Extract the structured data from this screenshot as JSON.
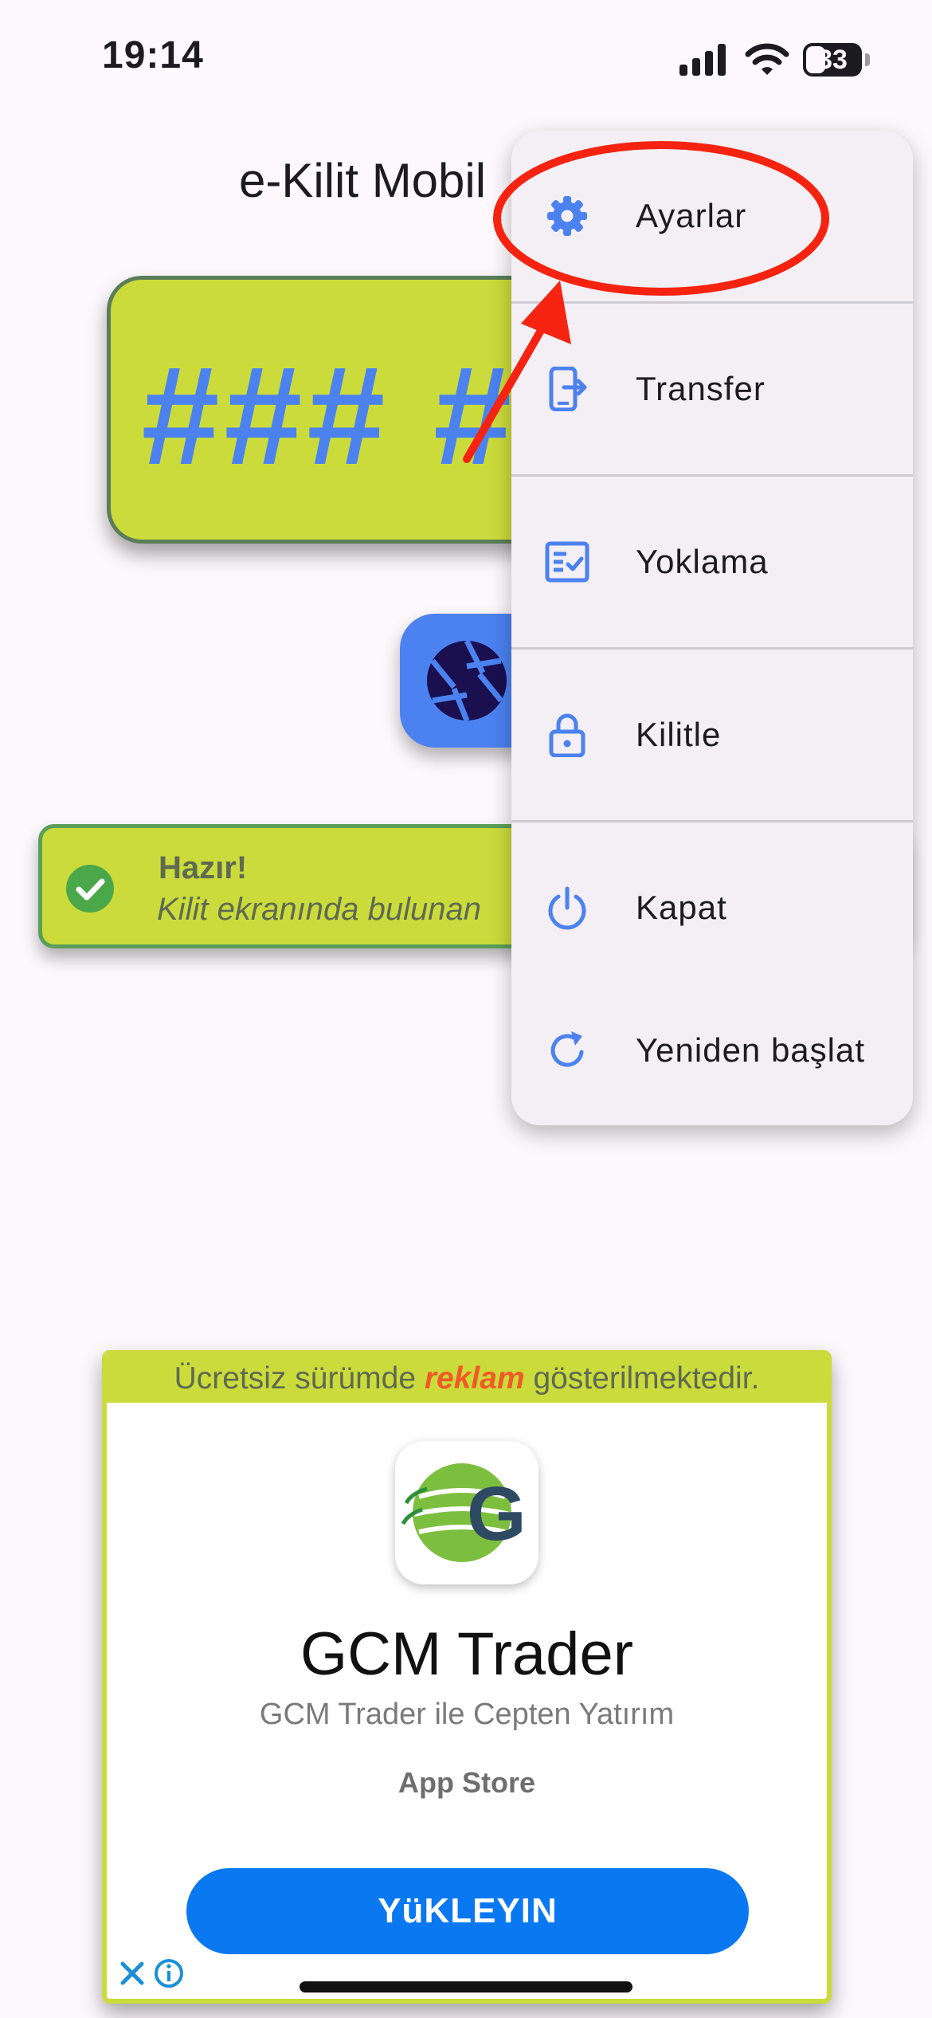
{
  "status_bar": {
    "time": "19:14",
    "battery": "33"
  },
  "app": {
    "title": "e-Kilit Mobil"
  },
  "code_card": {
    "code": "### #"
  },
  "status": {
    "title": "Hazır!",
    "message": "Kilit ekranında bulunan"
  },
  "menu": {
    "items": [
      {
        "label": "Ayarlar",
        "icon": "gear-icon"
      },
      {
        "label": "Transfer",
        "icon": "phone-transfer-icon"
      },
      {
        "label": "Yoklama",
        "icon": "checklist-icon"
      },
      {
        "label": "Kilitle",
        "icon": "lock-icon"
      },
      {
        "label": "Kapat",
        "icon": "power-icon"
      },
      {
        "label": "Yeniden başlat",
        "icon": "refresh-icon"
      }
    ]
  },
  "ad": {
    "notice_before": "Ücretsiz sürümde ",
    "notice_highlight": "reklam",
    "notice_after": " gösterilmektedir.",
    "app_name": "GCM Trader",
    "description": "GCM Trader ile Cepten Yatırım",
    "store": "App Store",
    "install_label": "YüKLEYIN"
  },
  "colors": {
    "accent": "#4b82f0",
    "card": "#cbdb3b",
    "annotation": "#f5230f",
    "install_button": "#0a78f0"
  }
}
